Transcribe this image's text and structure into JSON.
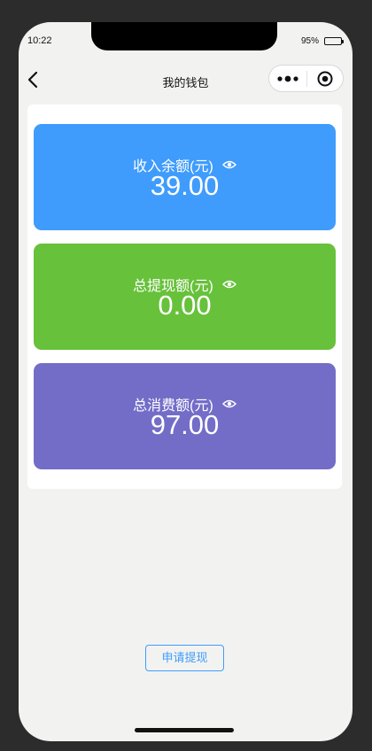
{
  "status_bar": {
    "time": "10:22",
    "battery_percent": "95%"
  },
  "nav": {
    "title": "我的钱包",
    "back_icon": "chevron-left-icon",
    "more_icon": "more-dots-icon",
    "close_icon": "target-circle-icon"
  },
  "cards": [
    {
      "label": "收入余额(元)",
      "value": "39.00",
      "color": "#3f9cfc"
    },
    {
      "label": "总提现额(元)",
      "value": "0.00",
      "color": "#67c13b"
    },
    {
      "label": "总消费额(元)",
      "value": "97.00",
      "color": "#736dc8"
    }
  ],
  "actions": {
    "withdraw_label": "申请提现"
  },
  "colors": {
    "background": "#f2f3f1",
    "accent": "#3f9cfc"
  }
}
